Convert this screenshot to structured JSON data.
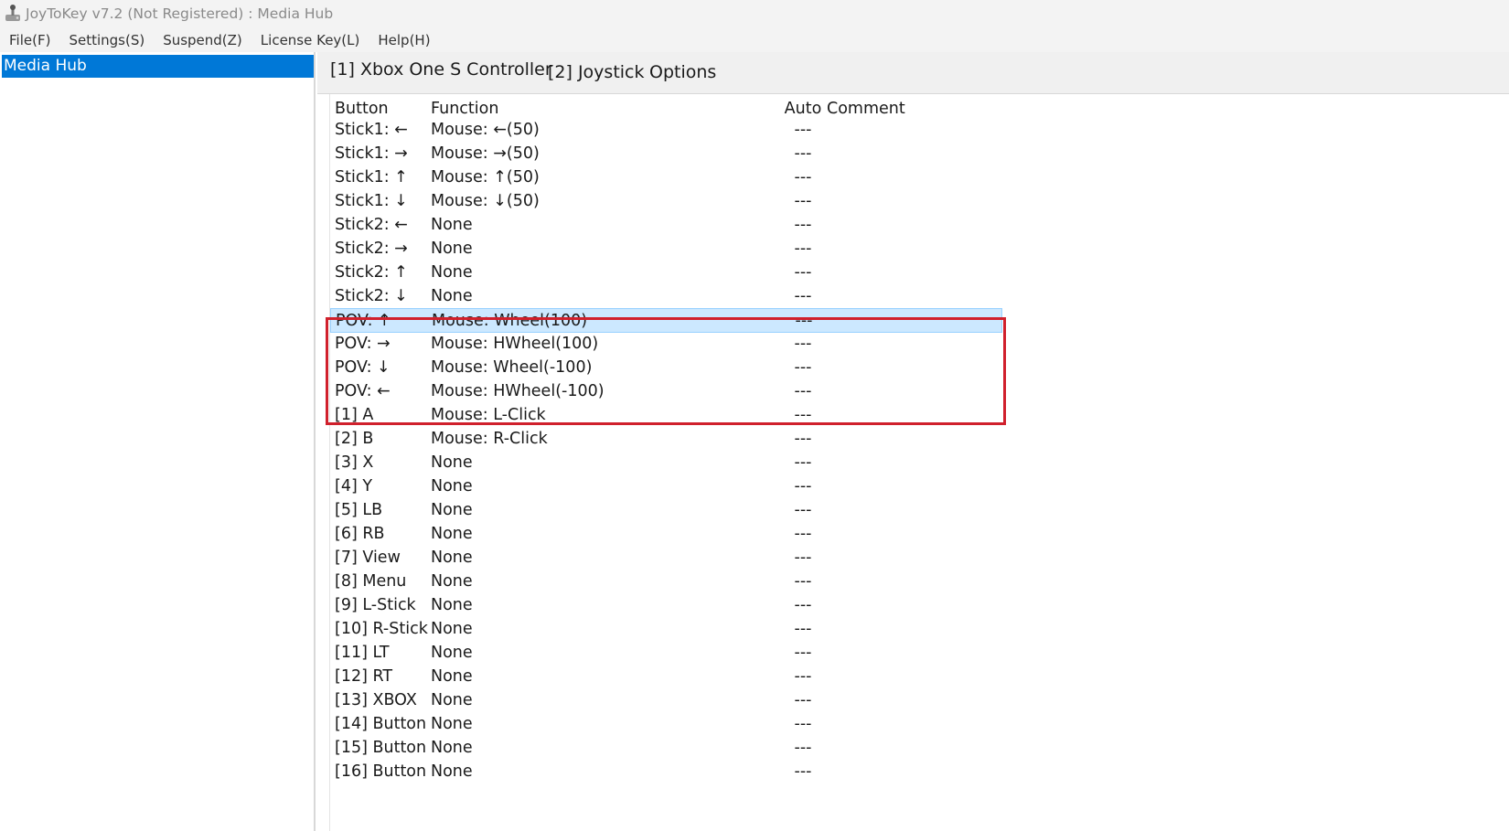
{
  "window": {
    "title": "JoyToKey v7.2 (Not Registered) : Media Hub"
  },
  "menu": [
    "File(F)",
    "Settings(S)",
    "Suspend(Z)",
    "License Key(L)",
    "Help(H)"
  ],
  "sidebar": {
    "items": [
      {
        "label": "Media Hub",
        "selected": true
      }
    ]
  },
  "tabs": [
    "[1] Xbox One S Controller",
    "[2] Joystick",
    "Options"
  ],
  "table": {
    "headers": {
      "button": "Button",
      "function": "Function",
      "auto": "Auto",
      "comment": "Comment"
    },
    "rows": [
      {
        "button": "Stick1: ←",
        "function": "Mouse: ←(50)",
        "auto": "---"
      },
      {
        "button": "Stick1: →",
        "function": "Mouse: →(50)",
        "auto": "---"
      },
      {
        "button": "Stick1: ↑",
        "function": "Mouse: ↑(50)",
        "auto": "---"
      },
      {
        "button": "Stick1: ↓",
        "function": "Mouse: ↓(50)",
        "auto": "---"
      },
      {
        "button": "Stick2: ←",
        "function": "None",
        "auto": "---"
      },
      {
        "button": "Stick2: →",
        "function": "None",
        "auto": "---"
      },
      {
        "button": "Stick2: ↑",
        "function": "None",
        "auto": "---"
      },
      {
        "button": "Stick2: ↓",
        "function": "None",
        "auto": "---"
      },
      {
        "button": "POV: ↑",
        "function": "Mouse: Wheel(100)",
        "auto": "---"
      },
      {
        "button": "POV: →",
        "function": "Mouse: HWheel(100)",
        "auto": "---"
      },
      {
        "button": "POV: ↓",
        "function": "Mouse: Wheel(-100)",
        "auto": "---"
      },
      {
        "button": "POV: ←",
        "function": "Mouse: HWheel(-100)",
        "auto": "---"
      },
      {
        "button": "[1] A",
        "function": "Mouse: L-Click",
        "auto": "---"
      },
      {
        "button": "[2] B",
        "function": "Mouse: R-Click",
        "auto": "---"
      },
      {
        "button": "[3] X",
        "function": "None",
        "auto": "---"
      },
      {
        "button": "[4] Y",
        "function": "None",
        "auto": "---"
      },
      {
        "button": "[5] LB",
        "function": "None",
        "auto": "---"
      },
      {
        "button": "[6] RB",
        "function": "None",
        "auto": "---"
      },
      {
        "button": "[7] View",
        "function": "None",
        "auto": "---"
      },
      {
        "button": "[8] Menu",
        "function": "None",
        "auto": "---"
      },
      {
        "button": "[9] L-Stick",
        "function": "None",
        "auto": "---"
      },
      {
        "button": "[10] R-Stick",
        "function": "None",
        "auto": "---"
      },
      {
        "button": "[11] LT",
        "function": "None",
        "auto": "---"
      },
      {
        "button": "[12] RT",
        "function": "None",
        "auto": "---"
      },
      {
        "button": "[13] XBOX",
        "function": "None",
        "auto": "---"
      },
      {
        "button": "[14] Button",
        "function": "None",
        "auto": "---"
      },
      {
        "button": "[15] Button",
        "function": "None",
        "auto": "---"
      },
      {
        "button": "[16] Button",
        "function": "None",
        "auto": "---"
      }
    ],
    "selected_row": 8
  },
  "colors": {
    "selection": "#cce8ff",
    "sidebar_selected": "#0078d7",
    "highlight_box": "#d0202c"
  },
  "icons": {
    "app": "joystick-icon"
  }
}
